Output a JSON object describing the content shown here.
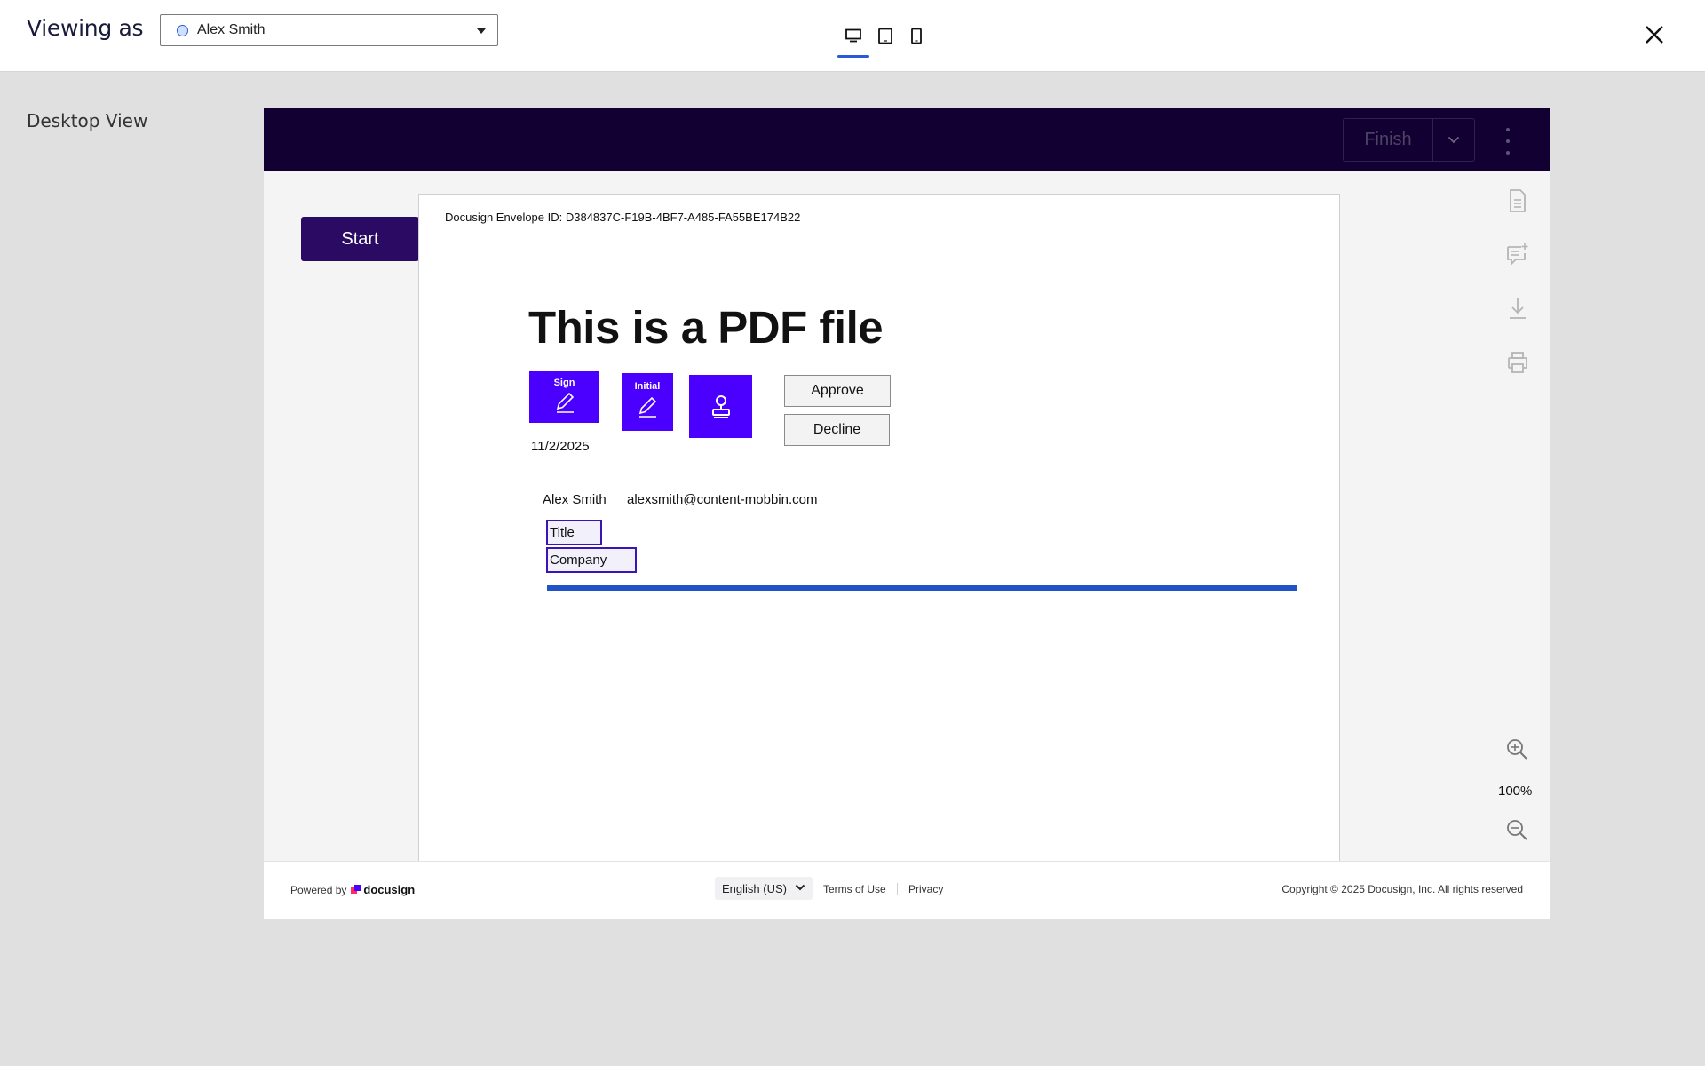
{
  "header": {
    "viewing_label": "Viewing as",
    "viewer_select_value": "Alex Smith",
    "device_icons": [
      "desktop-icon",
      "tablet-icon",
      "phone-icon"
    ],
    "active_device": "desktop",
    "close_icon": "close-icon"
  },
  "view_label": "Desktop View",
  "signing": {
    "finish_label": "Finish",
    "start_label": "Start",
    "document": {
      "envelope_id": "Docusign Envelope ID: D384837C-F19B-4BF7-A485-FA55BE174B22",
      "title": "This is a PDF file",
      "sign_label": "Sign",
      "initial_label": "Initial",
      "approve_label": "Approve",
      "decline_label": "Decline",
      "date": "11/2/2025",
      "signer_name": "Alex Smith",
      "signer_email": "alexsmith@content-mobbin.com",
      "title_field": "Title",
      "company_field": "Company"
    },
    "side_tools": [
      "document-icon",
      "add-comment-icon",
      "download-icon",
      "print-icon"
    ],
    "zoom_level": "100%"
  },
  "footer": {
    "powered_by": "Powered by",
    "brand": "docusign",
    "language": "English (US)",
    "terms": "Terms of Use",
    "privacy": "Privacy",
    "copyright": "Copyright © 2025 Docusign, Inc. All rights reserved"
  },
  "colors": {
    "purple_bar": "#130032",
    "start_button": "#2a0a62",
    "tag_purple": "#4b00ff",
    "accent_blue": "#2153c8"
  }
}
